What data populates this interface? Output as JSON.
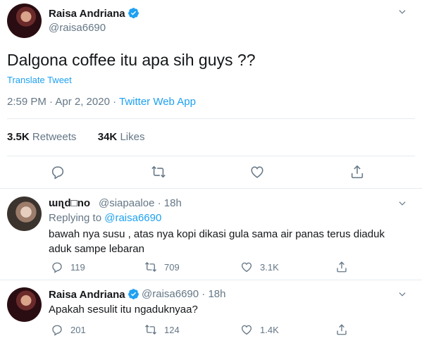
{
  "tweet": {
    "author_name": "Raisa Andriana",
    "author_handle": "@raisa6690",
    "text": "Dalgona coffee itu apa sih guys ??",
    "translate_label": "Translate Tweet",
    "time": "2:59 PM · Apr 2, 2020 · ",
    "source": "Twitter Web App",
    "retweets_count": "3.5K",
    "retweets_label": "Retweets",
    "likes_count": "34K",
    "likes_label": "Likes"
  },
  "replies": [
    {
      "author_name": "ɯıʅd□no",
      "author_handle": "@siapaaloe",
      "time": "· 18h",
      "replying_prefix": "Replying to",
      "replying_to": "@raisa6690",
      "text": "bawah nya susu , atas nya kopi dikasi gula sama air panas terus diaduk aduk sampe lebaran",
      "reply_count": "119",
      "retweet_count": "709",
      "like_count": "3.1K"
    },
    {
      "author_name": "Raisa Andriana",
      "author_handle": "@raisa6690",
      "time": "· 18h",
      "text": "Apakah sesulit itu ngaduknyaa?",
      "reply_count": "201",
      "retweet_count": "124",
      "like_count": "1.4K"
    }
  ],
  "colors": {
    "accent": "#1da1f2",
    "secondary_text": "#657786",
    "primary_text": "#14171a",
    "divider": "#e6ecf0"
  },
  "icons": [
    "verified-badge-icon",
    "chevron-down-icon",
    "reply-icon",
    "retweet-icon",
    "like-icon",
    "share-icon"
  ]
}
